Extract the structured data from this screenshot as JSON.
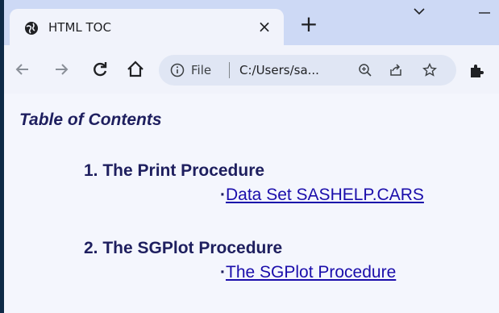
{
  "browser": {
    "tab": {
      "title": "HTML TOC",
      "close_glyph": "×",
      "favicon": "globe-icon"
    },
    "new_tab_glyph": "+",
    "omnibox": {
      "scheme_label": "File",
      "url": "C:/Users/sa..."
    }
  },
  "page": {
    "toc_title": "Table of Contents",
    "sections": [
      {
        "heading": "1. The Print Procedure",
        "bullet": "·",
        "link": "Data Set SASHELP.CARS"
      },
      {
        "heading": "2. The SGPlot Procedure",
        "bullet": "·",
        "link": "The SGPlot Procedure"
      }
    ]
  },
  "colors": {
    "frame": "#0e2a47",
    "tabstrip": "#cdd9f5",
    "toolbar": "#f1f3fb",
    "heading_text": "#1e1f5f",
    "link": "#1a0dab"
  }
}
